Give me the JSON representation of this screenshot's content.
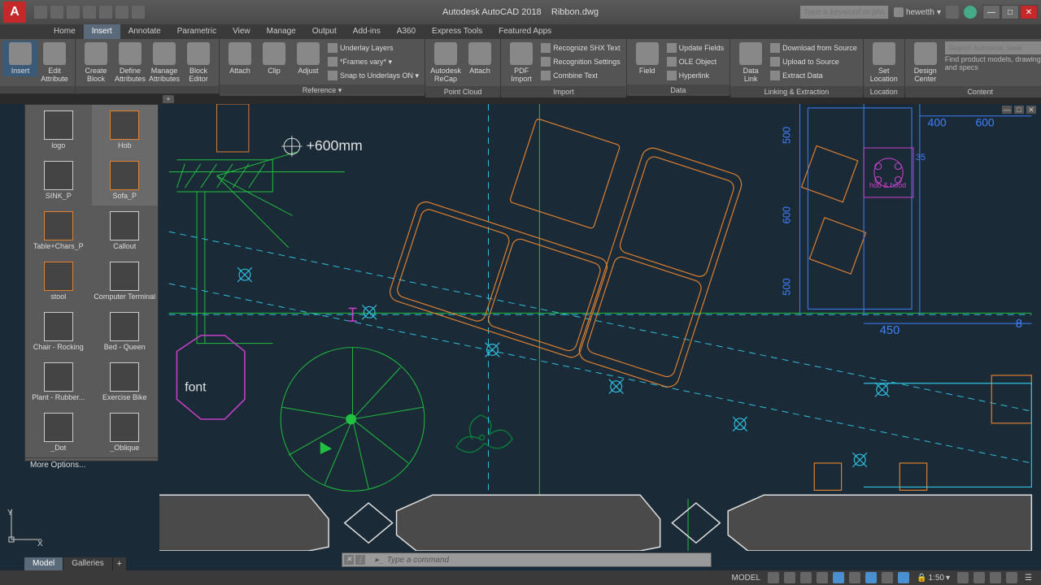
{
  "app": {
    "title_prefix": "Autodesk AutoCAD 2018",
    "filename": "Ribbon.dwg",
    "logo_text": "A",
    "search_placeholder": "Type a keyword or phrase",
    "user": "hewetth"
  },
  "menu_tabs": [
    "Home",
    "Insert",
    "Annotate",
    "Parametric",
    "View",
    "Manage",
    "Output",
    "Add-ins",
    "A360",
    "Express Tools",
    "Featured Apps"
  ],
  "menu_active_index": 1,
  "ribbon": {
    "groups": [
      {
        "label": "",
        "big": [
          {
            "l": "Insert",
            "hl": true
          },
          {
            "l": "Edit Attribute"
          }
        ]
      },
      {
        "label": "",
        "big": [
          {
            "l": "Create Block"
          },
          {
            "l": "Define Attributes"
          },
          {
            "l": "Manage Attributes"
          },
          {
            "l": "Block Editor"
          }
        ]
      },
      {
        "label": "Reference ▾",
        "big": [
          {
            "l": "Attach"
          },
          {
            "l": "Clip"
          },
          {
            "l": "Adjust"
          }
        ],
        "rows": [
          "Underlay Layers",
          "*Frames vary* ▾",
          "Snap to Underlays ON ▾"
        ]
      },
      {
        "label": "Point Cloud",
        "big": [
          {
            "l": "Autodesk ReCap"
          },
          {
            "l": "Attach"
          }
        ]
      },
      {
        "label": "Import",
        "big": [
          {
            "l": "PDF Import"
          }
        ],
        "rows": [
          "Recognize SHX Text",
          "Recognition Settings",
          "Combine Text"
        ]
      },
      {
        "label": "Data",
        "big": [
          {
            "l": "Field"
          }
        ],
        "rows": [
          "Update Fields",
          "OLE Object",
          "Hyperlink"
        ]
      },
      {
        "label": "Linking & Extraction",
        "big": [
          {
            "l": "Data Link"
          }
        ],
        "rows": [
          "Download from Source",
          "Upload to Source",
          "Extract Data"
        ]
      },
      {
        "label": "Location",
        "big": [
          {
            "l": "Set Location"
          }
        ]
      },
      {
        "label": "Content",
        "big": [
          {
            "l": "Design Center"
          }
        ],
        "search_placeholder": "Search Autodesk Seek",
        "text": "Find product models, drawings and specs"
      }
    ]
  },
  "palette": {
    "items": [
      {
        "label": "logo",
        "style": "white"
      },
      {
        "label": "Hob",
        "style": "orange",
        "sel": true
      },
      {
        "label": "SINK_P",
        "style": "white"
      },
      {
        "label": "Sofa_P",
        "style": "orange",
        "sel": true
      },
      {
        "label": "Table+Chars_P",
        "style": "orange"
      },
      {
        "label": "Callout",
        "style": "white"
      },
      {
        "label": "stool",
        "style": "orange"
      },
      {
        "label": "Computer Terminal",
        "style": "white"
      },
      {
        "label": "Chair - Rocking",
        "style": "white"
      },
      {
        "label": "Bed - Queen",
        "style": "white"
      },
      {
        "label": "Plant - Rubber...",
        "style": "white"
      },
      {
        "label": "Exercise Bike",
        "style": "white"
      },
      {
        "label": "_Dot",
        "style": "white"
      },
      {
        "label": "_Oblique",
        "style": "white"
      }
    ],
    "more": "More Options..."
  },
  "canvas": {
    "annotations": {
      "level": "+600mm",
      "font_label": "font",
      "dim_400": "400",
      "dim_600a": "600",
      "dim_600b": "600",
      "dim_500a": "500",
      "dim_500b": "500",
      "dim_35": "35",
      "dim_450": "450",
      "dim_8": "8",
      "hob_text": "hob & hood"
    },
    "colors": {
      "bg": "#1a2a36",
      "green": "#20c040",
      "cyan": "#30c0e0",
      "orange": "#e08030",
      "magenta": "#d040d0",
      "blue": "#4080ff",
      "white": "#e0e0e0",
      "darkgreen": "#0a7a3a"
    }
  },
  "command": {
    "placeholder": "Type a command"
  },
  "layout_tabs": [
    "Model",
    "Galleries"
  ],
  "layout_active": 0,
  "status": {
    "mode": "MODEL",
    "scale": "1:50"
  },
  "ucs": {
    "x": "X",
    "y": "Y"
  }
}
